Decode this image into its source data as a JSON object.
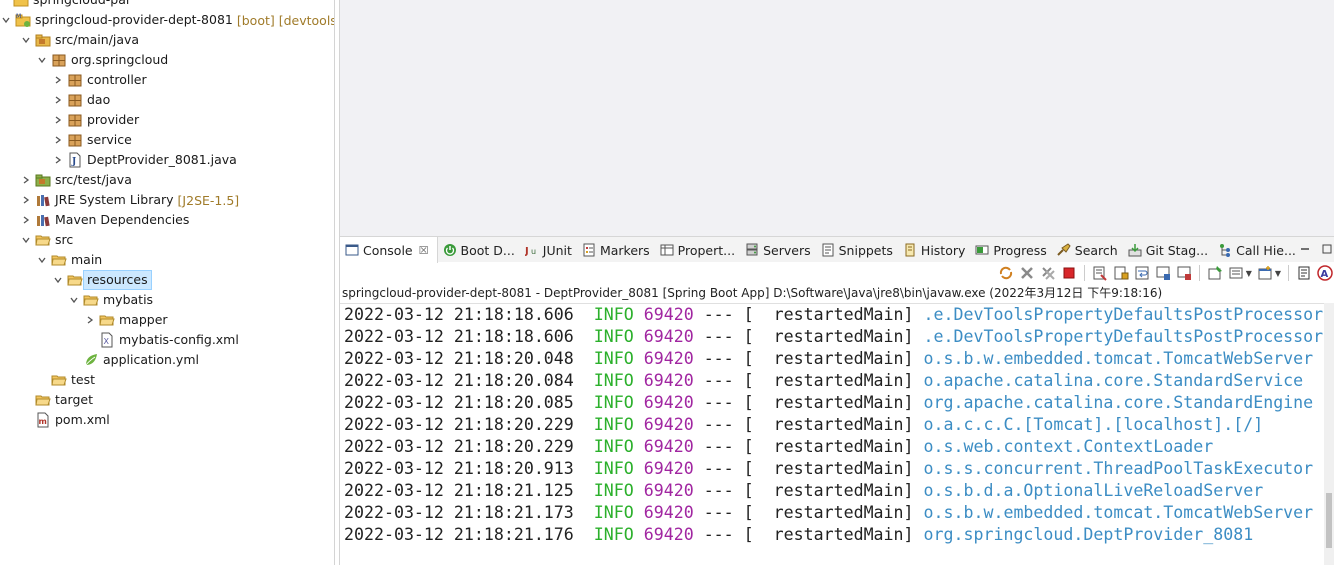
{
  "explorer": {
    "items": [
      {
        "label": "springcloud-pai",
        "decor": ""
      },
      {
        "label": "springcloud-provider-dept-8081",
        "decor": "[boot] [devtools]"
      },
      {
        "label": "src/main/java",
        "decor": ""
      },
      {
        "label": "org.springcloud",
        "decor": ""
      },
      {
        "label": "controller",
        "decor": ""
      },
      {
        "label": "dao",
        "decor": ""
      },
      {
        "label": "provider",
        "decor": ""
      },
      {
        "label": "service",
        "decor": ""
      },
      {
        "label": "DeptProvider_8081.java",
        "decor": ""
      },
      {
        "label": "src/test/java",
        "decor": ""
      },
      {
        "label": "JRE System Library",
        "decor": "[J2SE-1.5]"
      },
      {
        "label": "Maven Dependencies",
        "decor": ""
      },
      {
        "label": "src",
        "decor": ""
      },
      {
        "label": "main",
        "decor": ""
      },
      {
        "label": "resources",
        "decor": ""
      },
      {
        "label": "mybatis",
        "decor": ""
      },
      {
        "label": "mapper",
        "decor": ""
      },
      {
        "label": "mybatis-config.xml",
        "decor": ""
      },
      {
        "label": "application.yml",
        "decor": ""
      },
      {
        "label": "test",
        "decor": ""
      },
      {
        "label": "target",
        "decor": ""
      },
      {
        "label": "pom.xml",
        "decor": ""
      }
    ]
  },
  "console": {
    "tabs": [
      {
        "label": "Console",
        "icon": "console-icon",
        "close": "☒"
      },
      {
        "label": "Boot D...",
        "icon": "boot-dashboard-icon"
      },
      {
        "label": "JUnit",
        "icon": "junit-icon"
      },
      {
        "label": "Markers",
        "icon": "markers-icon"
      },
      {
        "label": "Propert...",
        "icon": "properties-icon"
      },
      {
        "label": "Servers",
        "icon": "servers-icon"
      },
      {
        "label": "Snippets",
        "icon": "snippets-icon"
      },
      {
        "label": "History",
        "icon": "history-icon"
      },
      {
        "label": "Progress",
        "icon": "progress-icon"
      },
      {
        "label": "Search",
        "icon": "search-icon"
      },
      {
        "label": "Git Stag...",
        "icon": "git-staging-icon"
      },
      {
        "label": "Call Hie...",
        "icon": "call-hierarchy-icon"
      }
    ],
    "process_title": "springcloud-provider-dept-8081 - DeptProvider_8081 [Spring Boot App] D:\\Software\\Java\\jre8\\bin\\javaw.exe  (2022年3月12日 下午9:18:16)",
    "log_lines": [
      {
        "ts": "2022-03-12 21:18:18.606",
        "level": "INFO",
        "pid": "69420",
        "sep": "---",
        "bracket": "[",
        "thread": "restartedMain]",
        "logger": ".e.DevToolsPropertyDefaultsPostProcessor"
      },
      {
        "ts": "2022-03-12 21:18:18.606",
        "level": "INFO",
        "pid": "69420",
        "sep": "---",
        "bracket": "[",
        "thread": "restartedMain]",
        "logger": ".e.DevToolsPropertyDefaultsPostProcessor"
      },
      {
        "ts": "2022-03-12 21:18:20.048",
        "level": "INFO",
        "pid": "69420",
        "sep": "---",
        "bracket": "[",
        "thread": "restartedMain]",
        "logger": "o.s.b.w.embedded.tomcat.TomcatWebServer"
      },
      {
        "ts": "2022-03-12 21:18:20.084",
        "level": "INFO",
        "pid": "69420",
        "sep": "---",
        "bracket": "[",
        "thread": "restartedMain]",
        "logger": "o.apache.catalina.core.StandardService"
      },
      {
        "ts": "2022-03-12 21:18:20.085",
        "level": "INFO",
        "pid": "69420",
        "sep": "---",
        "bracket": "[",
        "thread": "restartedMain]",
        "logger": "org.apache.catalina.core.StandardEngine"
      },
      {
        "ts": "2022-03-12 21:18:20.229",
        "level": "INFO",
        "pid": "69420",
        "sep": "---",
        "bracket": "[",
        "thread": "restartedMain]",
        "logger": "o.a.c.c.C.[Tomcat].[localhost].[/]"
      },
      {
        "ts": "2022-03-12 21:18:20.229",
        "level": "INFO",
        "pid": "69420",
        "sep": "---",
        "bracket": "[",
        "thread": "restartedMain]",
        "logger": "o.s.web.context.ContextLoader"
      },
      {
        "ts": "2022-03-12 21:18:20.913",
        "level": "INFO",
        "pid": "69420",
        "sep": "---",
        "bracket": "[",
        "thread": "restartedMain]",
        "logger": "o.s.s.concurrent.ThreadPoolTaskExecutor"
      },
      {
        "ts": "2022-03-12 21:18:21.125",
        "level": "INFO",
        "pid": "69420",
        "sep": "---",
        "bracket": "[",
        "thread": "restartedMain]",
        "logger": "o.s.b.d.a.OptionalLiveReloadServer"
      },
      {
        "ts": "2022-03-12 21:18:21.173",
        "level": "INFO",
        "pid": "69420",
        "sep": "---",
        "bracket": "[",
        "thread": "restartedMain]",
        "logger": "o.s.b.w.embedded.tomcat.TomcatWebServer"
      },
      {
        "ts": "2022-03-12 21:18:21.176",
        "level": "INFO",
        "pid": "69420",
        "sep": "---",
        "bracket": "[",
        "thread": "restartedMain]",
        "logger": "org.springcloud.DeptProvider_8081"
      }
    ],
    "colors": {
      "info": "#2bb02b",
      "pid": "#a126a1",
      "logger": "#3c8dc4"
    }
  }
}
